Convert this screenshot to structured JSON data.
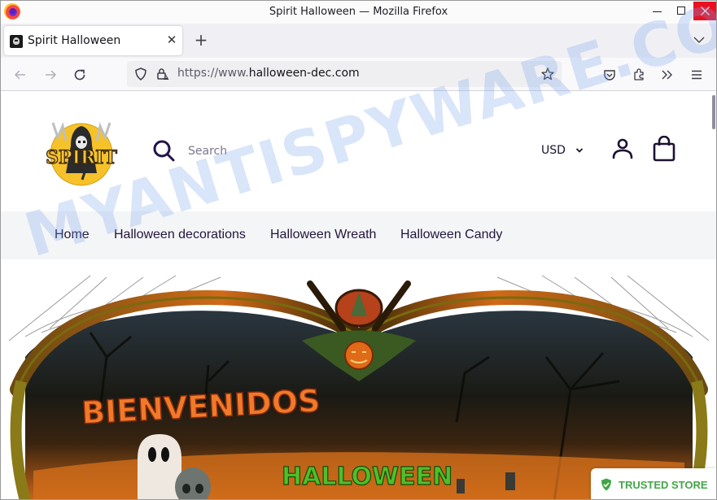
{
  "window": {
    "title": "Spirit Halloween — Mozilla Firefox",
    "minimize_label": "Minimize",
    "maximize_label": "Maximize",
    "close_label": "Close"
  },
  "tabs": [
    {
      "label": "Spirit Halloween",
      "favicon": "spirit-favicon",
      "active": true
    }
  ],
  "tabstrip": {
    "close_tab_glyph": "✕",
    "new_tab_glyph": "+"
  },
  "navbar": {
    "url_scheme": "https://www.",
    "url_domain": "halloween-dec.com",
    "icons": [
      "back-icon",
      "forward-icon",
      "reload-icon",
      "shield-icon",
      "lock-warning-icon",
      "bookmark-star-icon",
      "pocket-icon",
      "extensions-icon",
      "overflow-icon",
      "menu-icon"
    ]
  },
  "site": {
    "logo_text": "SPIRIT",
    "search": {
      "placeholder": "Search",
      "value": ""
    },
    "currency": {
      "selected": "USD"
    },
    "nav": [
      {
        "label": "Home"
      },
      {
        "label": "Halloween decorations"
      },
      {
        "label": "Halloween Wreath"
      },
      {
        "label": "Halloween Candy"
      }
    ],
    "banner": {
      "headline": "BIENVENIDOS",
      "subheadline": "HALLOWEEN"
    },
    "trust_badge": {
      "label": "TRUSTED STORE",
      "color": "#43a547"
    }
  },
  "watermark": {
    "text": "MYANTISPYWARE.COM"
  },
  "colors": {
    "close_button": "#e81123",
    "nav_text": "#22163d",
    "nav_bg": "#f4f5f7",
    "icon_dark": "#1c1230"
  }
}
